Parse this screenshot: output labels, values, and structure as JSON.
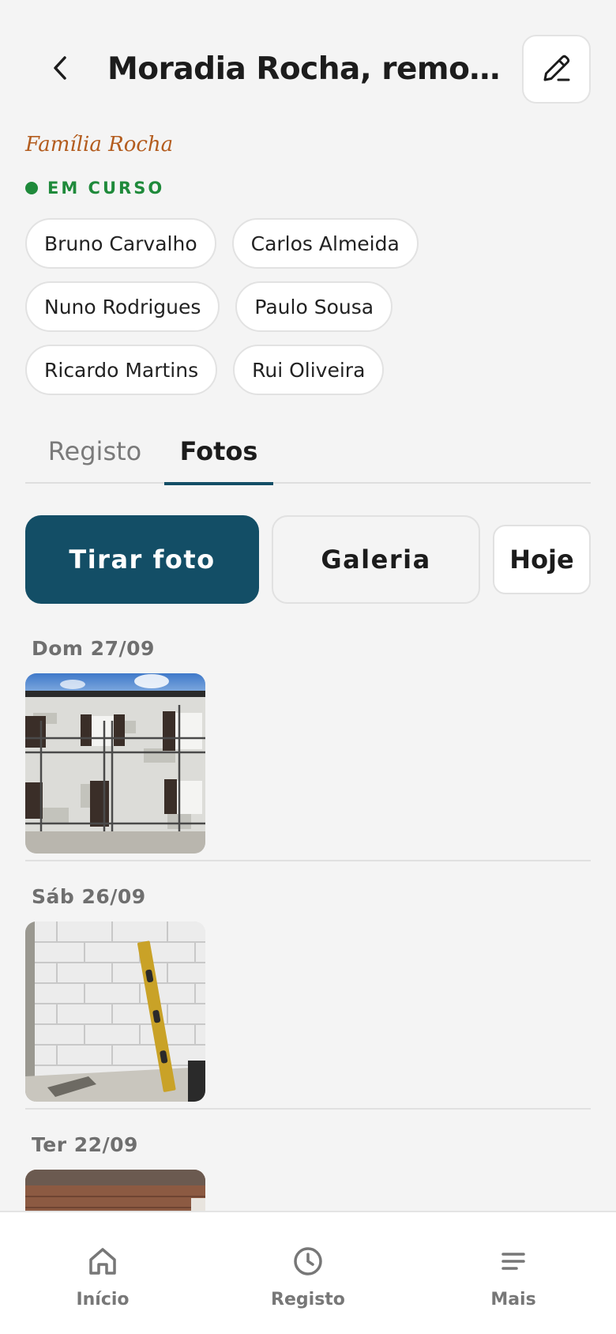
{
  "header": {
    "title": "Moradia Rocha, remodela…",
    "back_icon": "chevron-left-icon",
    "edit_icon": "pencil-icon"
  },
  "project": {
    "client": "Família Rocha",
    "status": "EM CURSO",
    "status_color": "#1f8a3b"
  },
  "team": [
    "Bruno Carvalho",
    "Carlos Almeida",
    "Nuno Rodrigues",
    "Paulo Sousa",
    "Ricardo Martins",
    "Rui Oliveira"
  ],
  "tabs": [
    {
      "label": "Registo",
      "active": false
    },
    {
      "label": "Fotos",
      "active": true
    }
  ],
  "actions": {
    "take_photo": "Tirar foto",
    "gallery": "Galeria",
    "today": "Hoje"
  },
  "photo_groups": [
    {
      "date": "Dom 27/09",
      "photos": [
        "building-facade-scaffolding"
      ]
    },
    {
      "date": "Sáb 26/09",
      "photos": [
        "tiled-wall-spirit-level"
      ]
    },
    {
      "date": "Ter 22/09",
      "photos": [
        "brick-wall-interior"
      ]
    }
  ],
  "nav": [
    {
      "label": "Início",
      "icon": "home-icon"
    },
    {
      "label": "Registo",
      "icon": "clock-icon"
    },
    {
      "label": "Mais",
      "icon": "menu-icon"
    }
  ],
  "colors": {
    "primary": "#134e66",
    "client_accent": "#b35c1e",
    "background": "#f4f4f4"
  }
}
